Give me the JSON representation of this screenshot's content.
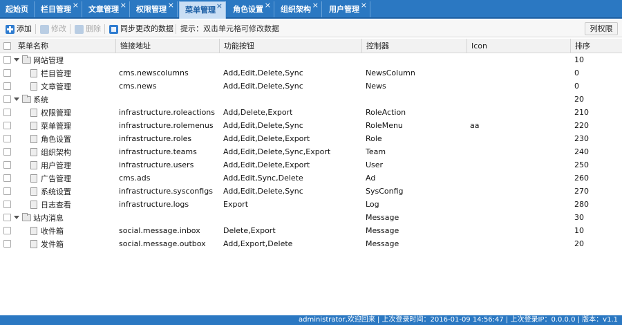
{
  "tabs": [
    {
      "label": "起始页",
      "closable": false
    },
    {
      "label": "栏目管理",
      "closable": true
    },
    {
      "label": "文章管理",
      "closable": true
    },
    {
      "label": "权限管理",
      "closable": true
    },
    {
      "label": "菜单管理",
      "closable": true,
      "active": true
    },
    {
      "label": "角色设置",
      "closable": true
    },
    {
      "label": "组织架构",
      "closable": true
    },
    {
      "label": "用户管理",
      "closable": true
    }
  ],
  "toolbar": {
    "add_label": "添加",
    "edit_label": "修改",
    "delete_label": "删除",
    "sync_label": "同步更改的数据",
    "hint": "提示：双击单元格可修改数据",
    "columns_label": "列权限"
  },
  "columns": [
    "菜单名称",
    "链接地址",
    "功能按钮",
    "控制器",
    "Icon",
    "排序"
  ],
  "rows": [
    {
      "name": "网站管理",
      "type": "folder",
      "link": "",
      "actions": "",
      "controller": "",
      "icon": "",
      "sort": "10"
    },
    {
      "name": "栏目管理",
      "type": "file",
      "link": "cms.newscolumns",
      "actions": "Add,Edit,Delete,Sync",
      "controller": "NewsColumn",
      "icon": "",
      "sort": "0"
    },
    {
      "name": "文章管理",
      "type": "file",
      "link": "cms.news",
      "actions": "Add,Edit,Delete,Sync",
      "controller": "News",
      "icon": "",
      "sort": "0"
    },
    {
      "name": "系统",
      "type": "folder",
      "link": "",
      "actions": "",
      "controller": "",
      "icon": "",
      "sort": "20"
    },
    {
      "name": "权限管理",
      "type": "file",
      "link": "infrastructure.roleactions",
      "actions": "Add,Delete,Export",
      "controller": "RoleAction",
      "icon": "",
      "sort": "210"
    },
    {
      "name": "菜单管理",
      "type": "file",
      "link": "infrastructure.rolemenus",
      "actions": "Add,Edit,Delete,Sync",
      "controller": "RoleMenu",
      "icon": "aa",
      "sort": "220"
    },
    {
      "name": "角色设置",
      "type": "file",
      "link": "infrastructure.roles",
      "actions": "Add,Edit,Delete,Export",
      "controller": "Role",
      "icon": "",
      "sort": "230"
    },
    {
      "name": "组织架构",
      "type": "file",
      "link": "infrastructure.teams",
      "actions": "Add,Edit,Delete,Sync,Export",
      "controller": "Team",
      "icon": "",
      "sort": "240"
    },
    {
      "name": "用户管理",
      "type": "file",
      "link": "infrastructure.users",
      "actions": "Add,Edit,Delete,Export",
      "controller": "User",
      "icon": "",
      "sort": "250"
    },
    {
      "name": "广告管理",
      "type": "file",
      "link": "cms.ads",
      "actions": "Add,Edit,Sync,Delete",
      "controller": "Ad",
      "icon": "",
      "sort": "260"
    },
    {
      "name": "系统设置",
      "type": "file",
      "link": "infrastructure.sysconfigs",
      "actions": "Add,Edit,Delete,Sync",
      "controller": "SysConfig",
      "icon": "",
      "sort": "270"
    },
    {
      "name": "日志查看",
      "type": "file",
      "link": "infrastructure.logs",
      "actions": "Export",
      "controller": "Log",
      "icon": "",
      "sort": "280"
    },
    {
      "name": "站内消息",
      "type": "folder",
      "link": "",
      "actions": "",
      "controller": "Message",
      "icon": "",
      "sort": "30"
    },
    {
      "name": "收件箱",
      "type": "file",
      "link": "social.message.inbox",
      "actions": "Delete,Export",
      "controller": "Message",
      "icon": "",
      "sort": "10"
    },
    {
      "name": "发件箱",
      "type": "file",
      "link": "social.message.outbox",
      "actions": "Add,Export,Delete",
      "controller": "Message",
      "icon": "",
      "sort": "20"
    }
  ],
  "status": {
    "text": "administrator,欢迎回来  |  上次登录时间：2016-01-09 14:56:47  |  上次登录IP：0.0.0.0  |  版本：v1.1"
  }
}
